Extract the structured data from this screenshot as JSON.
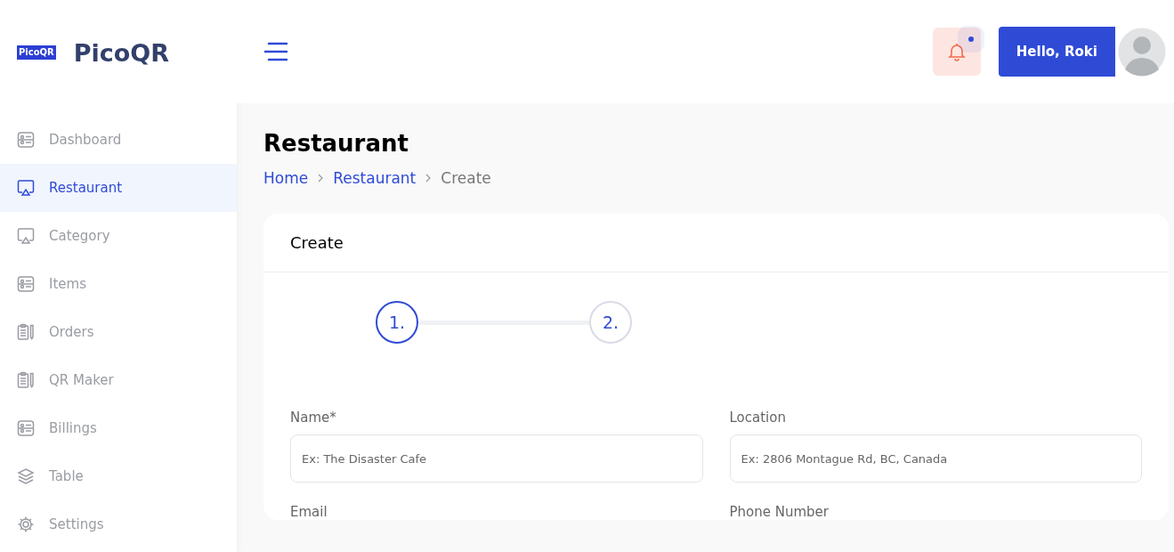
{
  "brand": {
    "logo_text": "PicoQR",
    "name": "PicoQR"
  },
  "sidebar": {
    "items": [
      {
        "label": "Dashboard",
        "kind": "list",
        "selected": false
      },
      {
        "label": "Restaurant",
        "kind": "monitor",
        "selected": true
      },
      {
        "label": "Category",
        "kind": "monitor",
        "selected": false
      },
      {
        "label": "Items",
        "kind": "list",
        "selected": false
      },
      {
        "label": "Orders",
        "kind": "clipboard",
        "selected": false
      },
      {
        "label": "QR Maker",
        "kind": "clipboard",
        "selected": false
      },
      {
        "label": "Billings",
        "kind": "list",
        "selected": false
      },
      {
        "label": "Table",
        "kind": "layers",
        "selected": false
      },
      {
        "label": "Settings",
        "kind": "gear",
        "selected": false
      }
    ]
  },
  "header": {
    "notifications": {
      "unread": true
    },
    "user_button": "Hello, Roki"
  },
  "page": {
    "title": "Restaurant",
    "breadcrumb": [
      {
        "label": "Home",
        "link": true
      },
      {
        "label": "Restaurant",
        "link": true
      },
      {
        "label": "Create",
        "link": false
      }
    ]
  },
  "card": {
    "title": "Create",
    "steps": [
      {
        "label": "1.",
        "selected": true
      },
      {
        "label": "2.",
        "selected": false
      }
    ],
    "fields": [
      {
        "label": "Name*",
        "placeholder": "Ex: The Disaster Cafe"
      },
      {
        "label": "Location",
        "placeholder": "Ex: 2806 Montague Rd, BC, Canada"
      },
      {
        "label": "Email"
      },
      {
        "label": "Phone Number"
      }
    ]
  }
}
